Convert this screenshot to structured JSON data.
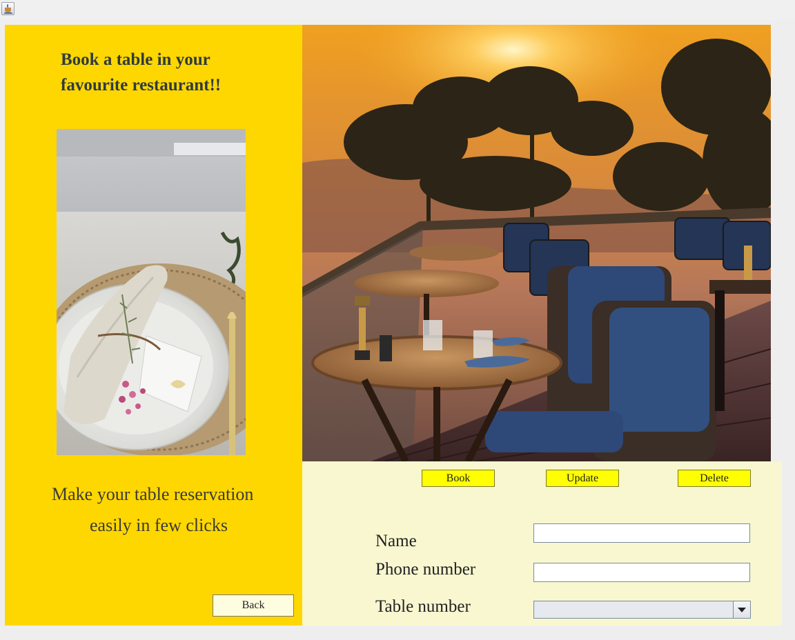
{
  "window": {
    "icon": "java-coffee-cup-icon"
  },
  "left_panel": {
    "headline": [
      "Book a table in your",
      "favourite restaurant!!"
    ],
    "tagline": [
      "Make your table reservation",
      "easily in few clicks"
    ],
    "back_label": "Back",
    "background_color": "#ffd700"
  },
  "images": {
    "napkin_photo": "napkin-place-setting-photo",
    "terrace_photo": "sunset-restaurant-terrace-photo"
  },
  "actions": {
    "book": "Book",
    "update": "Update",
    "delete": "Delete",
    "button_color": "#ffff00"
  },
  "form": {
    "name_label": "Name",
    "phone_label": "Phone number",
    "table_label": "Table number",
    "name_value": "",
    "phone_value": "",
    "table_value": "",
    "background_color": "#f8f7d0"
  }
}
